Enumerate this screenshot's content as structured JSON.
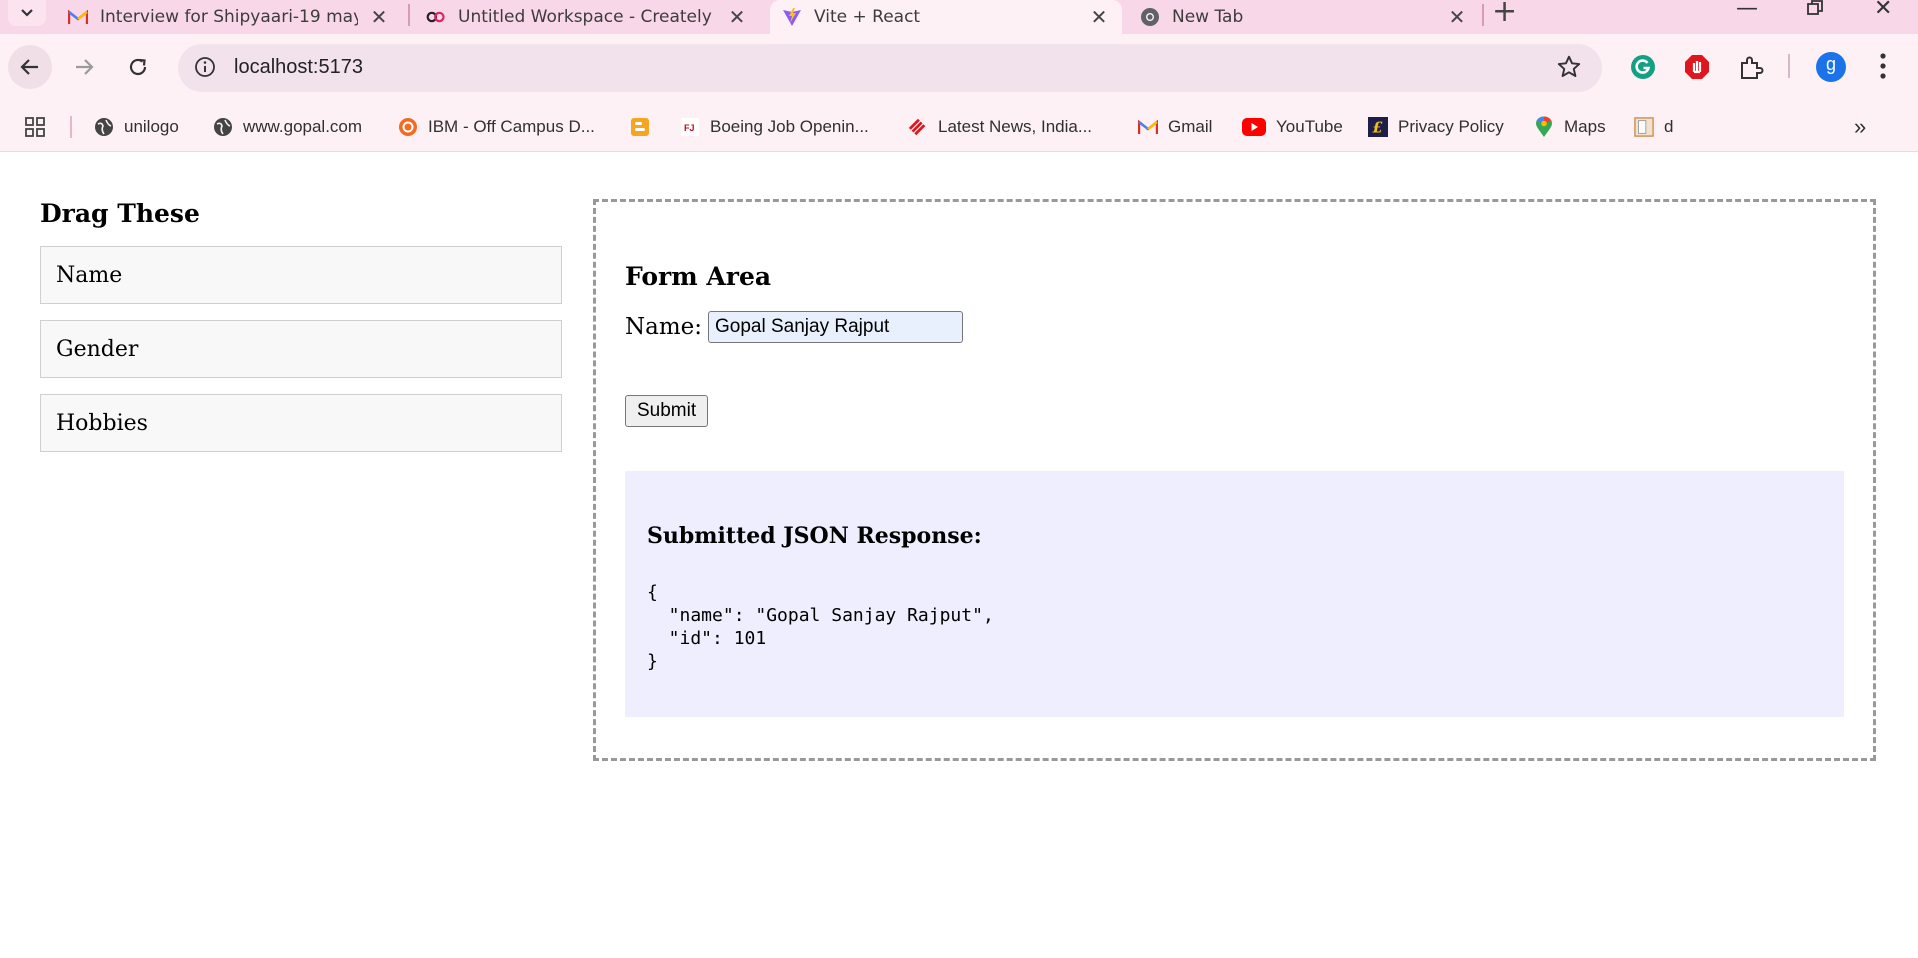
{
  "tabs": [
    {
      "title": "Interview for Shipyaari-19 may(",
      "icon": "gmail-icon"
    },
    {
      "title": "Untitled Workspace - Creately",
      "icon": "creately-icon"
    },
    {
      "title": "Vite + React",
      "icon": "vite-icon",
      "active": true
    },
    {
      "title": "New Tab",
      "icon": "chrome-icon"
    }
  ],
  "address_bar": {
    "url": "localhost:5173"
  },
  "profile": {
    "initial": "g"
  },
  "bookmarks": [
    {
      "label": "unilogo"
    },
    {
      "label": "www.gopal.com"
    },
    {
      "label": "IBM - Off Campus D..."
    },
    {
      "label": ""
    },
    {
      "label": "Boeing Job Openin..."
    },
    {
      "label": "Latest News, India..."
    },
    {
      "label": "Gmail"
    },
    {
      "label": "YouTube"
    },
    {
      "label": "Privacy Policy"
    },
    {
      "label": "Maps"
    },
    {
      "label": "d"
    }
  ],
  "palette": {
    "title": "Drag These",
    "items": [
      "Name",
      "Gender",
      "Hobbies"
    ]
  },
  "form": {
    "title": "Form Area",
    "name_label": "Name:",
    "name_value": "Gopal Sanjay Rajput",
    "submit_label": "Submit"
  },
  "response": {
    "title": "Submitted JSON Response:",
    "json": "{\n  \"name\": \"Gopal Sanjay Rajput\",\n  \"id\": 101\n}"
  }
}
